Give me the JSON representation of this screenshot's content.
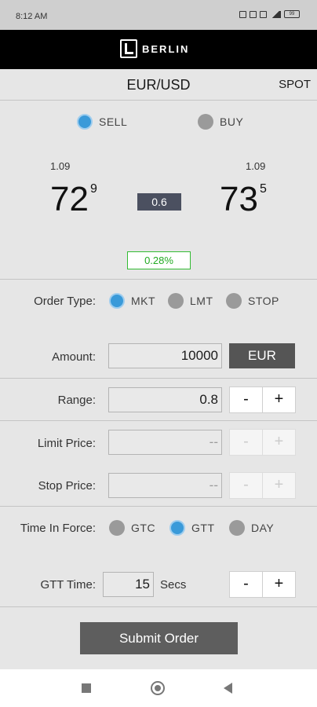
{
  "status_bar": {
    "time": "8:12 AM",
    "battery": "99"
  },
  "brand": {
    "name": "BERLIN"
  },
  "header": {
    "pair": "EUR/USD",
    "mode": "SPOT"
  },
  "side": {
    "sell_label": "SELL",
    "buy_label": "BUY",
    "selected": "SELL"
  },
  "prices": {
    "sell": {
      "prefix": "1.09",
      "big": "72",
      "pip": "9"
    },
    "buy": {
      "prefix": "1.09",
      "big": "73",
      "pip": "5"
    },
    "spread": "0.6",
    "change_pct": "0.28%"
  },
  "order_type": {
    "label": "Order Type:",
    "options": [
      "MKT",
      "LMT",
      "STOP"
    ],
    "selected": "MKT"
  },
  "amount": {
    "label": "Amount:",
    "value": "10000",
    "currency": "EUR"
  },
  "range": {
    "label": "Range:",
    "value": "0.8",
    "minus": "-",
    "plus": "+"
  },
  "limit_price": {
    "label": "Limit Price:",
    "value": "--",
    "minus": "-",
    "plus": "+"
  },
  "stop_price": {
    "label": "Stop Price:",
    "value": "--",
    "minus": "-",
    "plus": "+"
  },
  "time_in_force": {
    "label": "Time In Force:",
    "options": [
      "GTC",
      "GTT",
      "DAY"
    ],
    "selected": "GTT"
  },
  "gtt_time": {
    "label": "GTT Time:",
    "value": "15",
    "unit": "Secs",
    "minus": "-",
    "plus": "+"
  },
  "submit_label": "Submit Order",
  "colors": {
    "accent": "#3a9ad9",
    "brand_bg": "#000000",
    "positive": "#22aa22",
    "button_dark": "#5e5e5e"
  }
}
